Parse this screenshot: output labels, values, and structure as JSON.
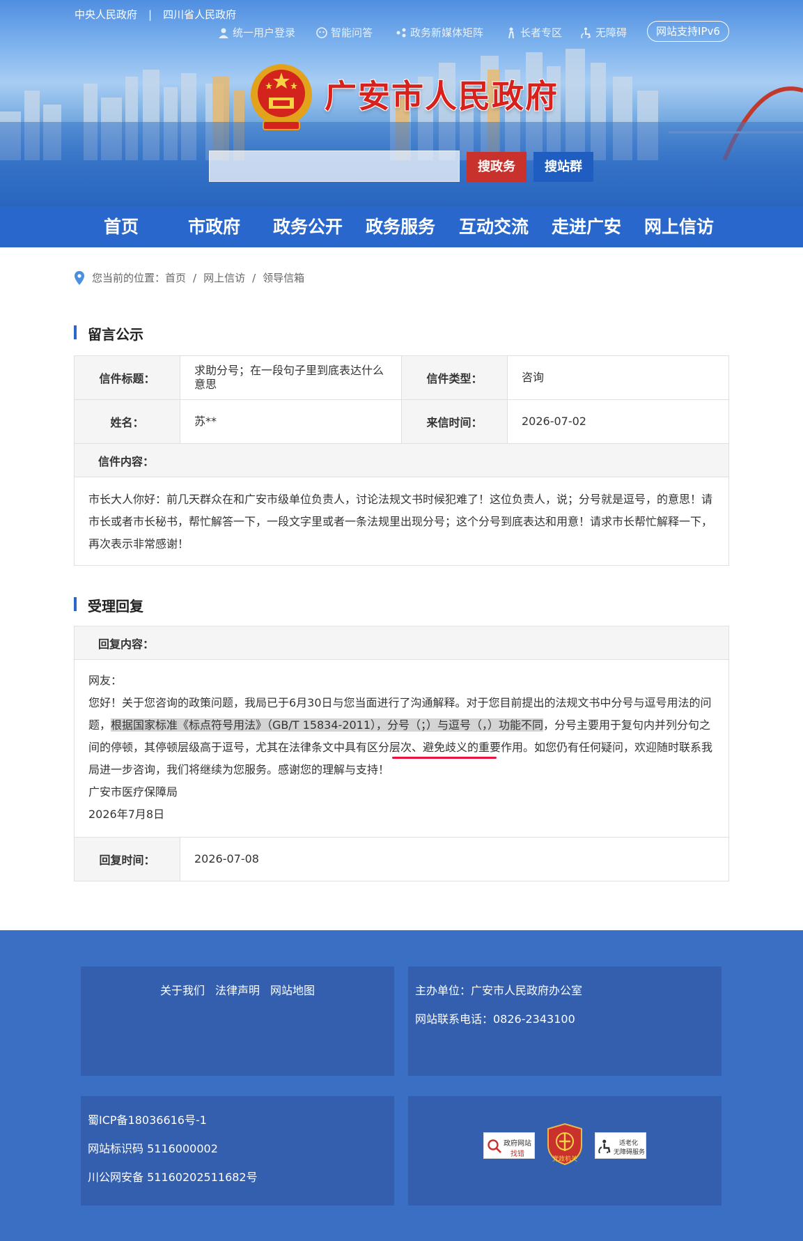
{
  "header": {
    "top_links": [
      "中央人民政府",
      "|",
      "四川省人民政府"
    ],
    "utilities": [
      {
        "label": "统一用户登录",
        "icon": "user-icon"
      },
      {
        "label": "智能问答",
        "icon": "robot-icon"
      },
      {
        "label": "政务新媒体矩阵",
        "icon": "media-icon"
      },
      {
        "label": "长者专区",
        "icon": "elder-icon"
      },
      {
        "label": "无障碍",
        "icon": "accessibility-icon"
      }
    ],
    "ipv6": "网站支持IPv6",
    "site_title": "广安市人民政府",
    "search_placeholder": "",
    "search_gov": "搜政务",
    "search_site": "搜站群"
  },
  "nav": [
    "首页",
    "市政府",
    "政务公开",
    "政务服务",
    "互动交流",
    "走进广安",
    "网上信访"
  ],
  "breadcrumb": {
    "prefix": "您当前的位置：",
    "items": [
      "首页",
      "网上信访",
      "领导信箱"
    ],
    "separator": "/"
  },
  "message": {
    "section_title": "留言公示",
    "title_label": "信件标题：",
    "title_value": "求助分号；在一段句子里到底表达什么意思",
    "type_label": "信件类型：",
    "type_value": "咨询",
    "name_label": "姓名：",
    "name_value": "苏**",
    "time_label": "来信时间：",
    "time_value": "2026-07-02",
    "content_label": "信件内容：",
    "content_value": "市长大人你好：前几天群众在和广安市级单位负责人，讨论法规文书时候犯难了！这位负责人，说；分号就是逗号，的意思！请市长或者市长秘书，帮忙解答一下，一段文字里或者一条法规里出现分号；这个分号到底表达和用意！请求市长帮忙解释一下，再次表示非常感谢！"
  },
  "reply": {
    "section_title": "受理回复",
    "content_label": "回复内容：",
    "greeting": "网友：",
    "para_start": "您好！关于您咨询的政策问题，我局已于6月30日与您当面进行了沟通解释。对于您目前提出的法规文书中分号与逗号用法的问题，",
    "para_highlight": "根据国家标准《标点符号用法》（GB/T 15834-2011），分号（；）与逗号（，）功能不同",
    "para_mid": "，分号主要用于复句内并列分句之间的停顿，其停顿层级高于逗号，尤其在法律条文中具有",
    "para_underline": "区分层次、避免歧义",
    "para_end": "的重要作用。如您仍有任何疑问，欢迎随时联系我局进一步咨询，我们将继续为您服务。感谢您的理解与支持！",
    "signature": "广安市医疗保障局",
    "date": "2026年7月8日",
    "time_label": "回复时间：",
    "time_value": "2026-07-08"
  },
  "footer": {
    "links": [
      "关于我们",
      "法律声明",
      "网站地图"
    ],
    "host": "主办单位：广安市人民政府办公室",
    "phone": "网站联系电话：0826-2343100",
    "icp": "蜀ICP备18036616号-1",
    "site_code": "网站标识码 5116000002",
    "police": "川公网安备 51160202511682号",
    "badges": [
      {
        "text1": "政府网站",
        "text2": "找错"
      },
      {
        "text1": "党政机关"
      },
      {
        "text1": "适老化",
        "text2": "无障碍服务"
      }
    ]
  },
  "colors": {
    "nav": "#2a67cd",
    "accent_red": "#c8312c",
    "accent_blue": "#1f5ec0",
    "footer": "#3b6fc4"
  }
}
